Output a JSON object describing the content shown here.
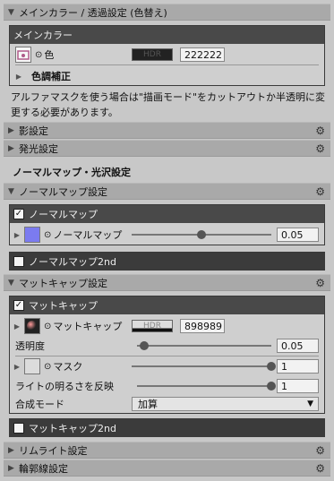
{
  "main_color_section": {
    "title": "メインカラー / 透過設定 (色替え)",
    "main_color_box": {
      "header": "メインカラー",
      "color_label": "色",
      "hdr_label": "HDR",
      "color_hex": "222222",
      "tone_correction_label": "色調補正"
    },
    "note": "アルファマスクを使う場合は\"描画モード\"をカットアウトか半透明に変更する必要があります。"
  },
  "shadow_foldout": "影設定",
  "emission_foldout": "発光設定",
  "normal_section_heading": "ノーマルマップ・光沢設定",
  "normal_foldout": "ノーマルマップ設定",
  "normal_box": {
    "header": "ノーマルマップ",
    "checked": true,
    "row_label": "ノーマルマップ",
    "value": "0.05",
    "slider_fraction": 0.5
  },
  "normal2_box": {
    "header": "ノーマルマップ2nd",
    "checked": false
  },
  "matcap_foldout": "マットキャップ設定",
  "matcap_box": {
    "header": "マットキャップ",
    "checked": true,
    "matcap_label": "マットキャップ",
    "hdr_label": "HDR",
    "color_hex": "898989",
    "transparency_label": "透明度",
    "transparency_value": "0.05",
    "transparency_fraction": 0.05,
    "mask_label": "マスク",
    "mask_value": "1",
    "mask_fraction": 1.0,
    "light_reflect_label": "ライトの明るさを反映",
    "light_reflect_value": "1",
    "light_reflect_fraction": 1.0,
    "blend_mode_label": "合成モード",
    "blend_mode_value": "加算"
  },
  "matcap2_box": {
    "header": "マットキャップ2nd",
    "checked": false
  },
  "rimlight_foldout": "リムライト設定",
  "outline_foldout": "輪郭線設定",
  "colors": {
    "header_bg": "#494949",
    "foldout_bg": "#a9a9a9",
    "panel_bg": "#c8c8c8",
    "normal_swatch": "#7b7bf0"
  }
}
